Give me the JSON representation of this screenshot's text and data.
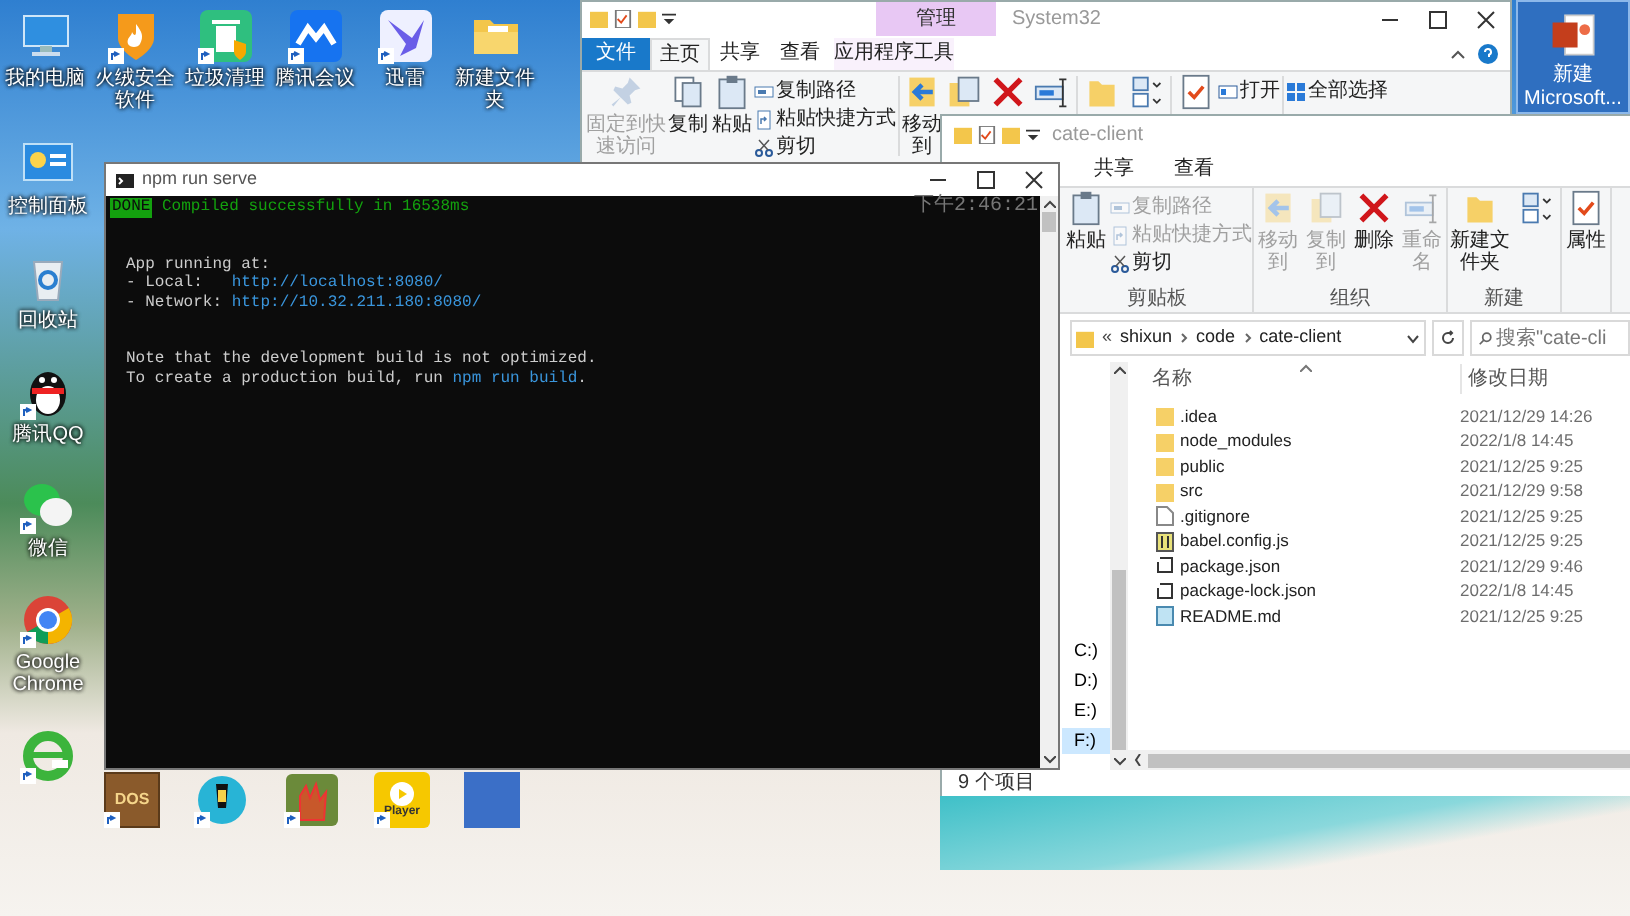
{
  "desktop": {
    "top_icons": [
      {
        "kind": "computer",
        "label": "我的电脑",
        "shortcut": false
      },
      {
        "kind": "shield",
        "label": "火绒安全软件",
        "shortcut": true
      },
      {
        "kind": "trash",
        "label": "垃圾清理",
        "shortcut": true
      },
      {
        "kind": "meeting",
        "label": "腾讯会议",
        "shortcut": true
      },
      {
        "kind": "bird",
        "label": "迅雷",
        "shortcut": true
      },
      {
        "kind": "folder",
        "label": "新建文件夹",
        "shortcut": false
      }
    ],
    "left_icons": [
      {
        "kind": "panel",
        "label": "控制面板",
        "shortcut": false
      },
      {
        "kind": "recycle",
        "label": "回收站",
        "shortcut": false
      },
      {
        "kind": "penguin",
        "label": "腾讯QQ",
        "shortcut": true
      },
      {
        "kind": "chat",
        "label": "微信",
        "shortcut": true
      },
      {
        "kind": "chrome",
        "label": "Google Chrome",
        "shortcut": true
      },
      {
        "kind": "ie",
        "shortcut": true
      }
    ],
    "bottom_icons": [
      {
        "kind": "dos",
        "text": "DOS",
        "shortcut": true
      },
      {
        "kind": "lamp",
        "shortcut": true
      },
      {
        "kind": "hand",
        "shortcut": true
      },
      {
        "kind": "player",
        "text": "Player",
        "shortcut": true
      },
      {
        "kind": "photo",
        "shortcut": false
      }
    ],
    "corner_icon": {
      "kind": "slides",
      "label": "新建 Microsoft...",
      "selected": true
    }
  },
  "back_explorer": {
    "title": "System32",
    "context_tab": "管理",
    "tabs": [
      {
        "label": "文件",
        "kind": "file",
        "selected": false
      },
      {
        "label": "主页",
        "kind": "tab",
        "selected": true
      },
      {
        "label": "共享",
        "kind": "tab",
        "selected": false
      },
      {
        "label": "查看",
        "kind": "tab",
        "selected": false
      },
      {
        "label": "应用程序工具",
        "kind": "context",
        "selected": false
      }
    ],
    "ribbon": [
      {
        "kind": "pin",
        "label": "固定到快速访问",
        "disabled": true
      },
      {
        "kind": "copy",
        "label": "复制",
        "disabled": false
      },
      {
        "kind": "clipboard",
        "label": "粘贴",
        "disabled": false
      },
      {
        "kind": "stack",
        "items": [
          {
            "kind": "path",
            "label": "复制路径",
            "disabled": false
          },
          {
            "kind": "shortcut",
            "label": "粘贴快捷方式",
            "disabled": false
          },
          {
            "kind": "scissors",
            "label": "剪切",
            "disabled": false
          }
        ]
      },
      {
        "kind": "separator"
      },
      {
        "kind": "move",
        "label": "移动到",
        "disabled": false
      },
      {
        "kind": "copyto",
        "disabled": false
      },
      {
        "kind": "delete",
        "disabled": false
      },
      {
        "kind": "rename",
        "disabled": false
      },
      {
        "kind": "separator"
      },
      {
        "kind": "folder",
        "disabled": false
      },
      {
        "kind": "pages",
        "disabled": false
      },
      {
        "kind": "separator"
      },
      {
        "kind": "properties",
        "disabled": false
      },
      {
        "kind": "stack",
        "items": [
          {
            "kind": "open",
            "label": "打开",
            "disabled": false
          }
        ]
      },
      {
        "kind": "separator"
      },
      {
        "kind": "stack",
        "items": [
          {
            "kind": "selectall",
            "label": "全部选择",
            "disabled": false
          }
        ]
      }
    ]
  },
  "explorer": {
    "title": "cate-client",
    "tabs": [
      {
        "label": "共享",
        "selected": false
      },
      {
        "label": "查看",
        "selected": false
      }
    ],
    "groups": [
      {
        "label": "剪贴板",
        "items": [
          {
            "kind": "clipboard",
            "label": "粘贴",
            "disabled": false
          },
          {
            "kind": "stack",
            "items": [
              {
                "kind": "path",
                "label": "复制路径",
                "disabled": true
              },
              {
                "kind": "shortcut",
                "label": "粘贴快捷方式",
                "disabled": true
              },
              {
                "kind": "scissors",
                "label": "剪切",
                "disabled": false
              }
            ]
          }
        ]
      },
      {
        "label": "组织",
        "items": [
          {
            "kind": "move",
            "label": "移动到",
            "disabled": true
          },
          {
            "kind": "copyto",
            "label": "复制到",
            "disabled": true
          },
          {
            "kind": "delete",
            "label": "删除",
            "disabled": false
          },
          {
            "kind": "rename",
            "label": "重命名",
            "disabled": true
          }
        ]
      },
      {
        "label": "新建",
        "items": [
          {
            "kind": "folder",
            "label": "新建文件夹",
            "disabled": false
          },
          {
            "kind": "pages",
            "disabled": false
          }
        ]
      },
      {
        "items": [
          {
            "kind": "properties",
            "label": "属性",
            "disabled": false
          }
        ]
      }
    ],
    "path": {
      "overflow": "«",
      "parts": [
        "shixun",
        "code",
        "cate-client"
      ]
    },
    "search": {
      "placeholder": "搜索\"cate-cli"
    },
    "drives": [
      {
        "label": "C:)",
        "selected": false
      },
      {
        "label": "D:)",
        "selected": false
      },
      {
        "label": "E:)",
        "selected": false
      },
      {
        "label": "F:)",
        "selected": true
      }
    ],
    "columns": [
      "名称",
      "修改日期"
    ],
    "files": [
      {
        "name": ".idea",
        "date": "2021/12/29 14:26",
        "kind": "folder"
      },
      {
        "name": "node_modules",
        "date": "2022/1/8 14:45",
        "kind": "folder"
      },
      {
        "name": "public",
        "date": "2021/12/25 9:25",
        "kind": "folder"
      },
      {
        "name": "src",
        "date": "2021/12/29 9:58",
        "kind": "folder"
      },
      {
        "name": ".gitignore",
        "date": "2021/12/25 9:25",
        "kind": "file"
      },
      {
        "name": "babel.config.js",
        "date": "2021/12/25 9:25",
        "kind": "script"
      },
      {
        "name": "package.json",
        "date": "2021/12/29 9:46",
        "kind": "json"
      },
      {
        "name": "package-lock.json",
        "date": "2022/1/8 14:45",
        "kind": "json"
      },
      {
        "name": "README.md",
        "date": "2021/12/25 9:25",
        "kind": "text"
      }
    ],
    "status": "9 个项目"
  },
  "terminal": {
    "title": "npm run serve",
    "time": "下午2:46:21",
    "blocks": [
      [
        [
          {
            "text": "DONE",
            "kind": "badge"
          },
          {
            "text": " Compiled successfully in 16538ms",
            "kind": "success"
          }
        ]
      ],
      [
        [
          {
            "text": "App running at:",
            "kind": "plain"
          }
        ],
        [
          {
            "text": "- Local:   ",
            "kind": "plain"
          },
          {
            "text": "http://localhost:8080/",
            "kind": "link"
          }
        ],
        [
          {
            "text": "- Network: ",
            "kind": "plain"
          },
          {
            "text": "http://10.32.211.180:8080/",
            "kind": "link"
          }
        ]
      ],
      [
        [
          {
            "text": "Note that the development build is not optimized.",
            "kind": "plain"
          }
        ],
        [
          {
            "text": "To create a production build, run ",
            "kind": "plain"
          },
          {
            "text": "npm run build",
            "kind": "link"
          },
          {
            "text": ".",
            "kind": "plain"
          }
        ]
      ]
    ]
  }
}
